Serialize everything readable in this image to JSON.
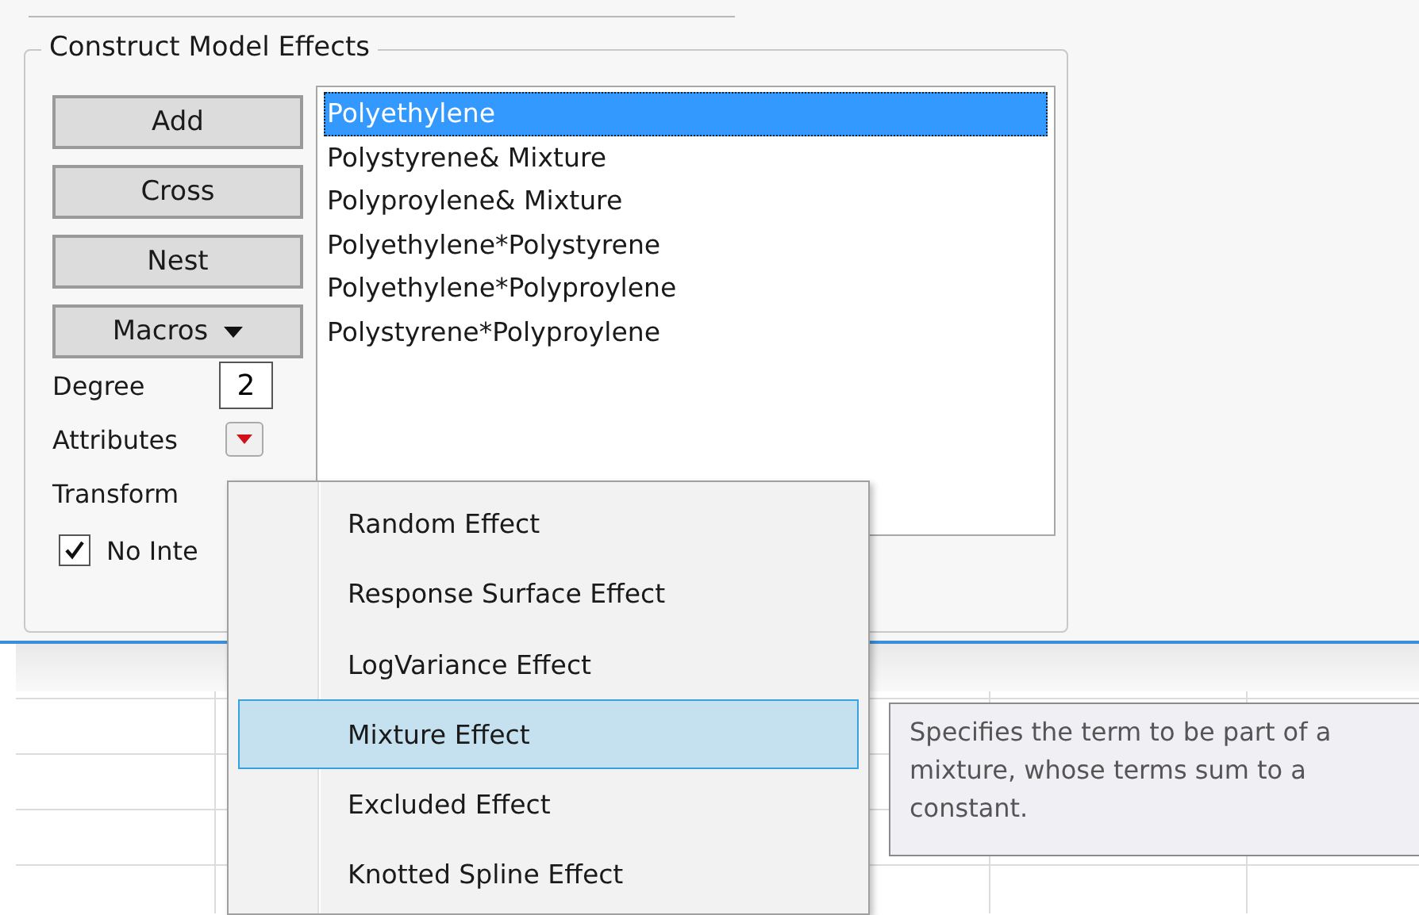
{
  "group": {
    "title": "Construct Model Effects"
  },
  "buttons": [
    {
      "label": "Add",
      "kind": "plain"
    },
    {
      "label": "Cross",
      "kind": "plain"
    },
    {
      "label": "Nest",
      "kind": "plain"
    },
    {
      "label": "Macros",
      "kind": "menu"
    }
  ],
  "degree": {
    "label": "Degree",
    "value": "2"
  },
  "attributes": {
    "label": "Attributes"
  },
  "transform": {
    "label": "Transform"
  },
  "no_intercept": {
    "label": "No Inte",
    "checked": true
  },
  "effects": [
    {
      "label": "Polyethylene",
      "selected": true
    },
    {
      "label": "Polystyrene& Mixture",
      "selected": false
    },
    {
      "label": "Polyproylene& Mixture",
      "selected": false
    },
    {
      "label": "Polyethylene*Polystyrene",
      "selected": false
    },
    {
      "label": "Polyethylene*Polyproylene",
      "selected": false
    },
    {
      "label": "Polystyrene*Polyproylene",
      "selected": false
    }
  ],
  "menu": [
    {
      "label": "Random Effect",
      "selected": false
    },
    {
      "label": "Response Surface Effect",
      "selected": false
    },
    {
      "label": "LogVariance Effect",
      "selected": false
    },
    {
      "label": "Mixture Effect",
      "selected": true
    },
    {
      "label": "Excluded Effect",
      "selected": false
    },
    {
      "label": "Knotted Spline Effect",
      "selected": false
    }
  ],
  "tooltip": {
    "text": "Specifies the term to be part of a mixture, whose terms sum to a constant."
  }
}
